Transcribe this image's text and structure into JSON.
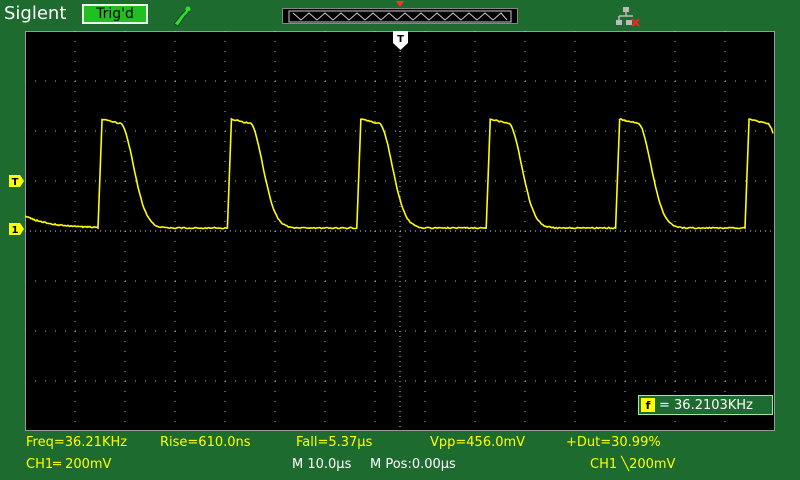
{
  "header": {
    "brand": "Siglent",
    "trigger_status": "Trig'd"
  },
  "markers": {
    "time_marker": "T",
    "trigger_level_marker": "T",
    "channel_marker": "1"
  },
  "readout": {
    "freq_icon": "f",
    "freq_value": "= 36.2103KHz"
  },
  "measurements": {
    "freq": "Freq=36.21KHz",
    "rise": "Rise=610.0ns",
    "fall": "Fall=5.37µs",
    "vpp": "Vpp=456.0mV",
    "duty": "+Dut=30.99%"
  },
  "status_bar": {
    "ch1_scale": "CH1═ 200mV",
    "timebase": "M 10.0µs",
    "mpos": "M Pos:0.00µs",
    "trigger": "CH1 ╲200mV"
  },
  "colors": {
    "background": "#1e6b2f",
    "screen": "#000000",
    "trace": "#ffff00",
    "grid": "#c8c8c8"
  }
}
